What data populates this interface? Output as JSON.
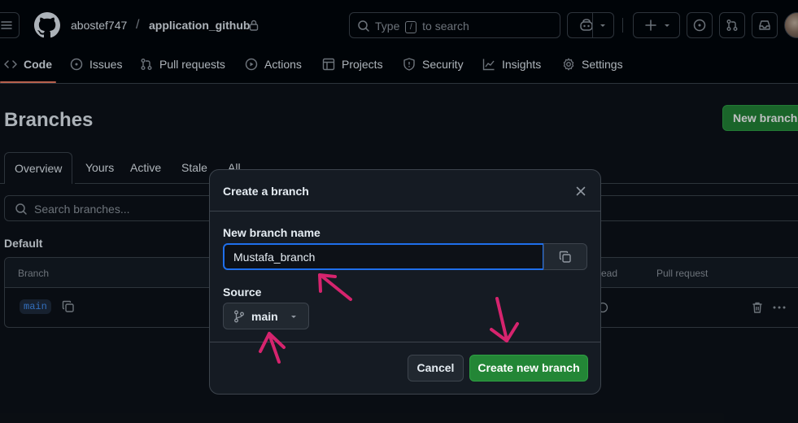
{
  "header": {
    "owner": "abostef747",
    "separator": "/",
    "repo": "application_github",
    "search_prefix": "Type",
    "search_key": "/",
    "search_suffix": "to search"
  },
  "repo_nav": {
    "items": [
      {
        "label": "Code",
        "icon": "code-icon",
        "active": true
      },
      {
        "label": "Issues",
        "icon": "issue-opened-icon"
      },
      {
        "label": "Pull requests",
        "icon": "git-pull-request-icon"
      },
      {
        "label": "Actions",
        "icon": "play-icon"
      },
      {
        "label": "Projects",
        "icon": "table-icon"
      },
      {
        "label": "Security",
        "icon": "shield-icon"
      },
      {
        "label": "Insights",
        "icon": "graph-icon"
      },
      {
        "label": "Settings",
        "icon": "gear-icon"
      }
    ]
  },
  "page": {
    "title": "Branches",
    "new_branch_label": "New branch",
    "tabs": [
      "Overview",
      "Yours",
      "Active",
      "Stale",
      "All"
    ],
    "search_placeholder": "Search branches...",
    "section_title": "Default",
    "table": {
      "columns": [
        "Branch",
        "ead",
        "Pull request"
      ],
      "rows": [
        {
          "branch": "main"
        }
      ]
    }
  },
  "modal": {
    "title": "Create a branch",
    "name_label": "New branch name",
    "name_value": "Mustafa_branch",
    "source_label": "Source",
    "source_value": "main",
    "cancel_label": "Cancel",
    "create_label": "Create new branch"
  },
  "colors": {
    "bg": "#0d1117",
    "header_bg": "#010409",
    "border": "#3d444d",
    "primary_green": "#238636",
    "focus_blue": "#1f6feb",
    "annotation": "#d6246e"
  }
}
